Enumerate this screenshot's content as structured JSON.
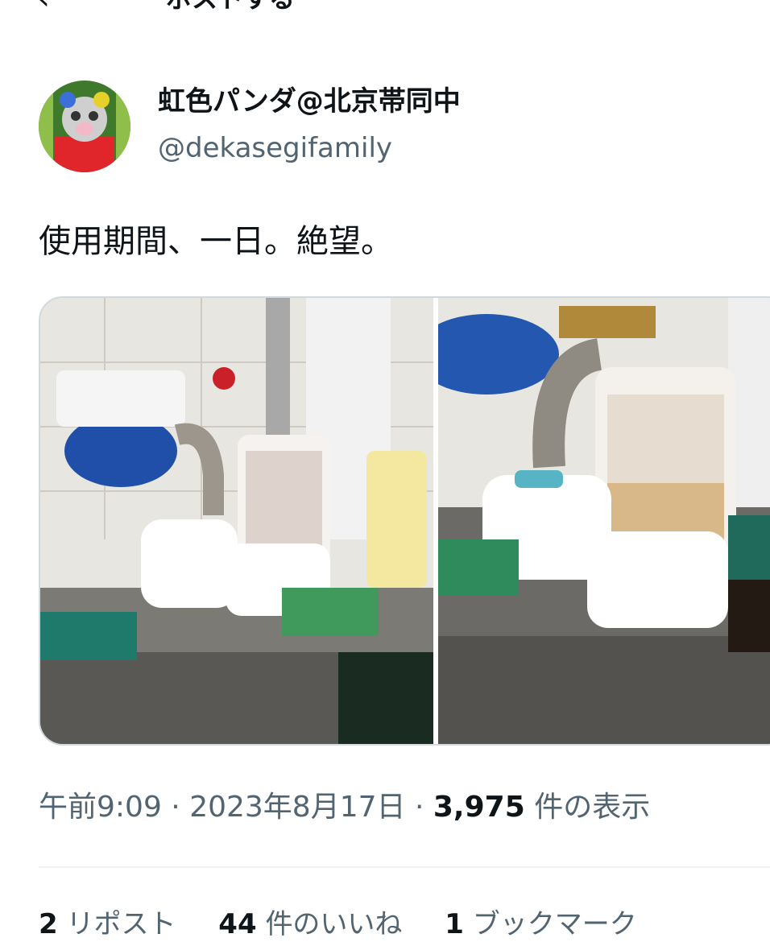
{
  "header": {
    "back_icon": "back-arrow-icon",
    "title": "ポストする"
  },
  "author": {
    "display_name": "虹色パンダ@北京帯同中",
    "handle": "@dekasegifamily"
  },
  "post": {
    "text": "使用期間、一日。絶望。",
    "time": "午前9:09",
    "date": "2023年8月17日",
    "views_count": "3,975",
    "views_label": "件の表示"
  },
  "engagement": {
    "reposts_count": "2",
    "reposts_label": "リポスト",
    "likes_count": "44",
    "likes_label": "件のいいね",
    "bookmarks_count": "1",
    "bookmarks_label": "ブックマーク"
  },
  "colors": {
    "text": "#0f1419",
    "secondary": "#536471",
    "border": "#cfd9de"
  }
}
